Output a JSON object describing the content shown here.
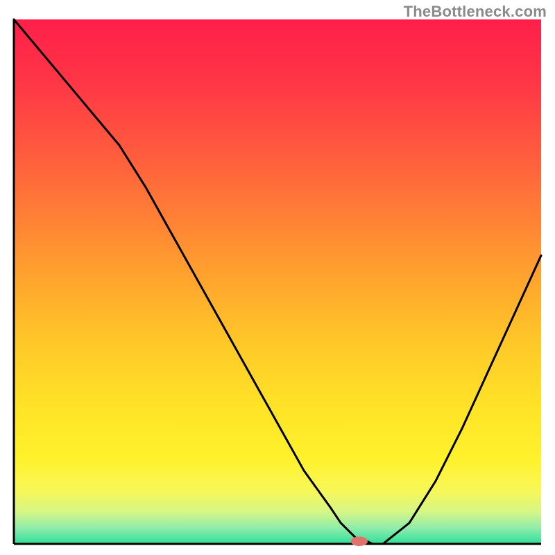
{
  "watermark": "TheBottleneck.com",
  "chart_data": {
    "type": "line",
    "title": "",
    "xlabel": "",
    "ylabel": "",
    "xlim": [
      0,
      100
    ],
    "ylim": [
      0,
      100
    ],
    "x": [
      0,
      5,
      10,
      15,
      20,
      25,
      30,
      35,
      40,
      45,
      50,
      55,
      60,
      62,
      64,
      65,
      66,
      68,
      70,
      75,
      80,
      85,
      90,
      95,
      100
    ],
    "y": [
      100,
      94,
      88,
      82,
      76,
      68,
      59,
      50,
      41,
      32,
      23,
      14,
      7,
      4,
      2,
      1,
      1,
      0,
      0,
      4,
      12,
      22,
      33,
      44,
      55
    ],
    "background": {
      "type": "vertical-gradient",
      "stops": [
        {
          "pos": 0.0,
          "color": "#ff1f4a"
        },
        {
          "pos": 0.12,
          "color": "#ff3646"
        },
        {
          "pos": 0.25,
          "color": "#ff5a3e"
        },
        {
          "pos": 0.38,
          "color": "#ff8135"
        },
        {
          "pos": 0.5,
          "color": "#ffa62d"
        },
        {
          "pos": 0.62,
          "color": "#ffc928"
        },
        {
          "pos": 0.74,
          "color": "#ffe327"
        },
        {
          "pos": 0.84,
          "color": "#fff22c"
        },
        {
          "pos": 0.9,
          "color": "#f7f75a"
        },
        {
          "pos": 0.94,
          "color": "#d4f688"
        },
        {
          "pos": 0.97,
          "color": "#8eecaa"
        },
        {
          "pos": 1.0,
          "color": "#2fe09a"
        }
      ]
    },
    "marker": {
      "x": 65.5,
      "y": 0.5,
      "rx": 1.6,
      "ry": 0.9,
      "color": "#e0716c"
    },
    "axis_color": "#000000"
  }
}
